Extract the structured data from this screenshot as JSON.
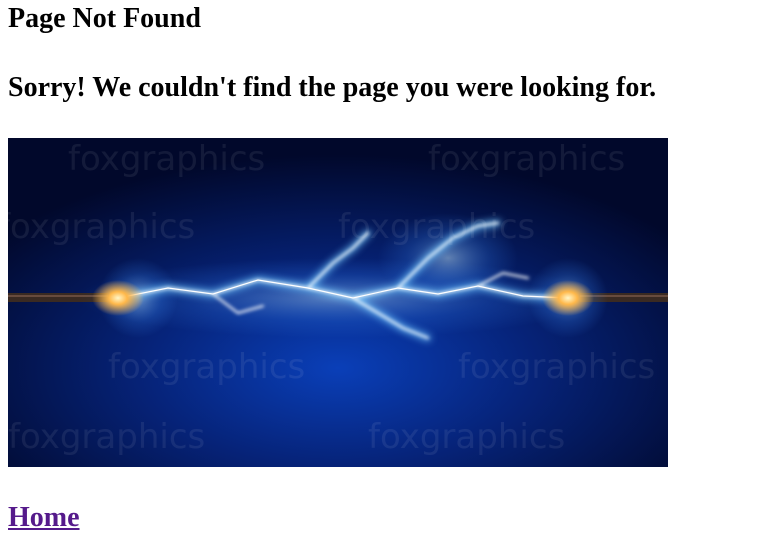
{
  "page": {
    "heading": "Page Not Found",
    "message": "Sorry! We couldn't find the page you were looking for."
  },
  "image": {
    "subject": "electric-spark-between-two-wires",
    "watermark_text": "foxgraphics",
    "colors": {
      "background_dark": "#01082b",
      "background_glow": "#0a3fb8",
      "arc_core": "#ffffff",
      "arc_glow": "#6fc6ff",
      "spark_fire": "#ffb84a",
      "wire": "#3a2a22"
    }
  },
  "nav": {
    "home_label": "Home",
    "link_color": "#551a8b"
  }
}
